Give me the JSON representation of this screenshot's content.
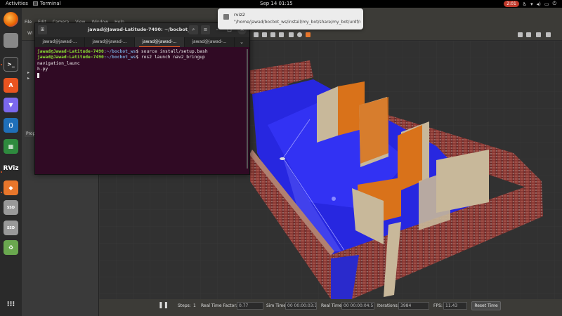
{
  "topbar": {
    "activities": "Activities",
    "app_name": "Terminal",
    "clock": "Sep 14  01:15",
    "rec_time": "2:01"
  },
  "notification": {
    "title": "rviz2",
    "body": "\"/home/jawad/bocbot_ws/install/my_bot/share/my_bot/urdf/r..."
  },
  "rviz": {
    "menu": [
      "File",
      "Edit",
      "Camera",
      "View",
      "Window",
      "Help"
    ]
  },
  "terminal": {
    "title": "jawad@Jawad-Latitude-7490: ~/bocbot_ws",
    "tabs": [
      "jawad@jawad-...",
      "jawad@jawad-...",
      "jawad@jawad-...",
      "jawad@jawad-..."
    ],
    "lines": [
      {
        "user": "jawad@Jawad-Latitude-7490",
        "path": ":~/bocbot_ws",
        "cmd": "$ source install/setup.bash"
      },
      {
        "user": "jawad@Jawad-Latitude-7490",
        "path": ":~/bocbot_ws",
        "cmd": "$ ros2 launch nav2_bringup navigation_launc"
      }
    ],
    "wrap": "h.py"
  },
  "bottom_bar": {
    "steps_label": "Steps:",
    "steps_value": "1",
    "rtf_label": "Real Time Factor:",
    "rtf_value": "0.77",
    "sim_label": "Sim Time:",
    "sim_value": "00 00:00:03:54.764",
    "real_label": "Real Time:",
    "real_value": "00 00:00:04:51.118",
    "iter_label": "Iterations:",
    "iter_value": "3984",
    "fps_label": "FPS:",
    "fps_value": "11.43",
    "reset_label": "Reset Time"
  },
  "left_panel": {
    "header_label": "Wi",
    "props_label": "Prop"
  },
  "colors": {
    "terminal_bg": "#300a24",
    "brick": "#8b3a35",
    "floor_blue": "#2222dd",
    "door_orange": "#d9721a",
    "accent": "#e95420"
  }
}
